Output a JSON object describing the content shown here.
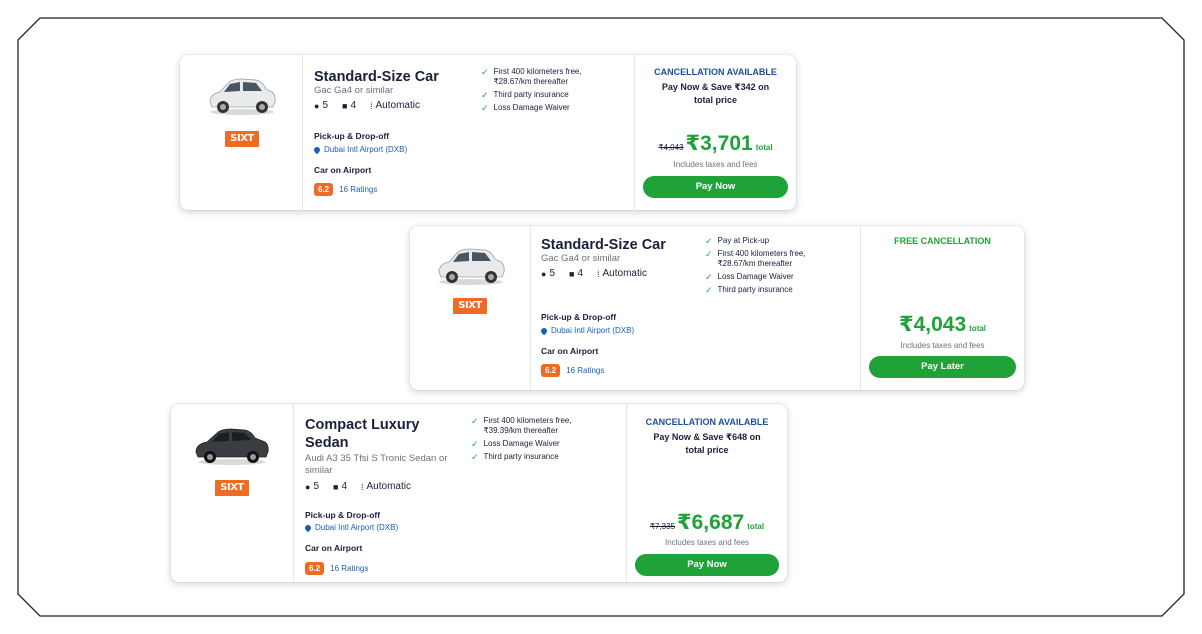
{
  "colors": {
    "accent_green": "#1fa339",
    "brand_orange": "#ef6a22",
    "link_blue": "#1b5fb5",
    "cancel_blue": "#1b4f9c"
  },
  "cards": [
    {
      "title": "Standard-Size Car",
      "subtitle": "Gac Ga4 or similar",
      "seats": "5",
      "bags": "4",
      "transmission": "Automatic",
      "brand": "SIXT",
      "pickup_label": "Pick-up & Drop-off",
      "location": "Dubai Intl Airport (DXB)",
      "car_location": "Car on Airport",
      "rating_score": "6.2",
      "rating_count": "16 Ratings",
      "features": [
        "First 400 kilometers free, ₹28.67/km thereafter",
        "Third party insurance",
        "Loss Damage Waiver"
      ],
      "cancellation": "CANCELLATION AVAILABLE",
      "save_text": "Pay Now & Save ₹342 on total price",
      "old_price": "₹4,043",
      "price": "₹3,701",
      "total_label": "total",
      "taxes": "Includes taxes and fees",
      "button": "Pay Now"
    },
    {
      "title": "Standard-Size Car",
      "subtitle": "Gac Ga4 or similar",
      "seats": "5",
      "bags": "4",
      "transmission": "Automatic",
      "brand": "SIXT",
      "pickup_label": "Pick-up & Drop-off",
      "location": "Dubai Intl Airport (DXB)",
      "car_location": "Car on Airport",
      "rating_score": "6.2",
      "rating_count": "16 Ratings",
      "features": [
        "Pay at Pick-up",
        "First 400 kilometers free, ₹28.67/km thereafter",
        "Loss Damage Waiver",
        "Third party insurance"
      ],
      "cancellation": "FREE CANCELLATION",
      "price": "₹4,043",
      "total_label": "total",
      "taxes": "Includes taxes and fees",
      "button": "Pay Later"
    },
    {
      "title": "Compact Luxury Sedan",
      "subtitle": "Audi A3 35 Tfsi S Tronic Sedan or similar",
      "seats": "5",
      "bags": "4",
      "transmission": "Automatic",
      "brand": "SIXT",
      "pickup_label": "Pick-up & Drop-off",
      "location": "Dubai Intl Airport (DXB)",
      "car_location": "Car on Airport",
      "rating_score": "6.2",
      "rating_count": "16 Ratings",
      "features": [
        "First 400 kilometers free, ₹39.39/km thereafter",
        "Loss Damage Waiver",
        "Third party insurance"
      ],
      "cancellation": "CANCELLATION AVAILABLE",
      "save_text": "Pay Now & Save ₹648 on total price",
      "old_price": "₹7,335",
      "price": "₹6,687",
      "total_label": "total",
      "taxes": "Includes taxes and fees",
      "button": "Pay Now"
    }
  ]
}
